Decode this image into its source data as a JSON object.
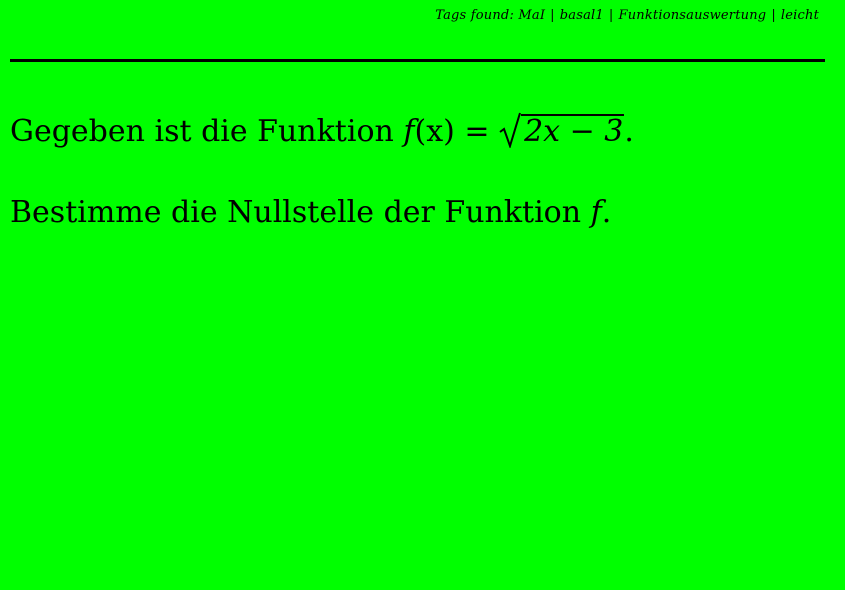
{
  "header": {
    "prefix": "Tags found:",
    "tags": [
      "MaI",
      "basal1",
      "Funktionsauswertung",
      "leicht"
    ],
    "separator": "|"
  },
  "task": {
    "intro": "Gegeben ist die Funktion",
    "function_name": "f",
    "function_arg": "(x)",
    "equals": "=",
    "radicand": "2x − 3",
    "end_punct": ".",
    "question_text": "Bestimme die Nullstelle der Funktion",
    "question_symbol": "f",
    "question_end": "."
  },
  "colors": {
    "background": "#00ff00",
    "text": "#000000"
  }
}
